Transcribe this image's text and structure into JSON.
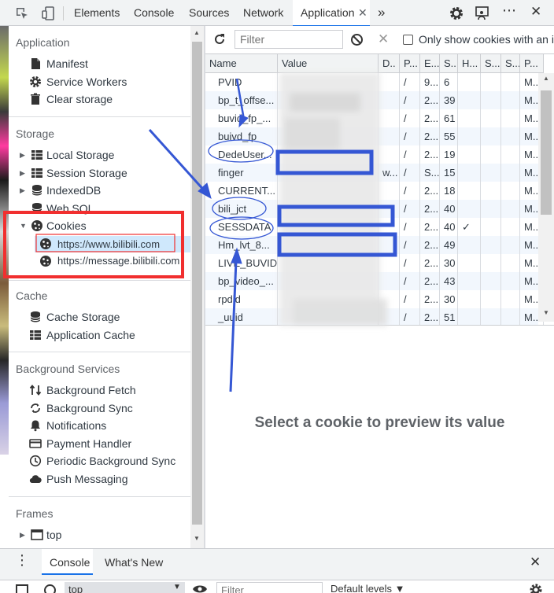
{
  "devtools": {
    "tabs": [
      "Elements",
      "Console",
      "Sources",
      "Network",
      "Application"
    ],
    "active_tab": "Application",
    "more_tabs_icon": "chevron-double-right-icon",
    "toolbar_icons": [
      "inspect-icon",
      "device-toggle-icon",
      "gear-icon",
      "feedback-icon",
      "more-icon",
      "close-icon"
    ]
  },
  "sidebar": {
    "application": {
      "title": "Application",
      "items": [
        "Manifest",
        "Service Workers",
        "Clear storage"
      ]
    },
    "storage": {
      "title": "Storage",
      "items": [
        "Local Storage",
        "Session Storage",
        "IndexedDB",
        "Web SQL",
        "Cookies"
      ],
      "cookies_children": [
        "https://www.bilibili.com",
        "https://message.bilibili.com"
      ]
    },
    "cache": {
      "title": "Cache",
      "items": [
        "Cache Storage",
        "Application Cache"
      ]
    },
    "background": {
      "title": "Background Services",
      "items": [
        "Background Fetch",
        "Background Sync",
        "Notifications",
        "Payment Handler",
        "Periodic Background Sync",
        "Push Messaging"
      ]
    },
    "frames": {
      "title": "Frames",
      "items": [
        "top"
      ]
    }
  },
  "cookies_toolbar": {
    "filter_placeholder": "Filter",
    "only_issues_label": "Only show cookies with an iss"
  },
  "cookies_table": {
    "columns": [
      "Name",
      "Value",
      "D..",
      "P...",
      "E...",
      "S...",
      "H...",
      "S...",
      "S...",
      "P..."
    ],
    "rows": [
      {
        "name": "PVID",
        "path": "/",
        "expires": "9...",
        "size": "6",
        "http": "",
        "prio": "M..."
      },
      {
        "name": "bp_t_offse...",
        "path": "/",
        "expires": "2...",
        "size": "39",
        "http": "",
        "prio": "M..."
      },
      {
        "name": "buvid_fp_...",
        "path": "/",
        "expires": "2...",
        "size": "61",
        "http": "",
        "prio": "M..."
      },
      {
        "name": "buivd_fp",
        "path": "/",
        "expires": "2...",
        "size": "55",
        "http": "",
        "prio": "M..."
      },
      {
        "name": "DedeUser...",
        "path": "/",
        "expires": "2...",
        "size": "19",
        "http": "",
        "prio": "M..."
      },
      {
        "name": "finger",
        "domain": "w...",
        "path": "/",
        "expires": "S...",
        "size": "15",
        "http": "",
        "prio": "M..."
      },
      {
        "name": "CURRENT...",
        "path": "/",
        "expires": "2...",
        "size": "18",
        "http": "",
        "prio": "M..."
      },
      {
        "name": "bili_jct",
        "path": "/",
        "expires": "2...",
        "size": "40",
        "http": "",
        "prio": "M..."
      },
      {
        "name": "SESSDATA",
        "path": "/",
        "expires": "2...",
        "size": "40",
        "http": "✓",
        "prio": "M..."
      },
      {
        "name": "Hm_lvt_8...",
        "path": "/",
        "expires": "2...",
        "size": "49",
        "http": "",
        "prio": "M..."
      },
      {
        "name": "LIVE_BUVID",
        "path": "/",
        "expires": "2...",
        "size": "30",
        "http": "",
        "prio": "M..."
      },
      {
        "name": "bp_video_...",
        "path": "/",
        "expires": "2...",
        "size": "43",
        "http": "",
        "prio": "M..."
      },
      {
        "name": "rpdid",
        "path": "/",
        "expires": "2...",
        "size": "30",
        "http": "",
        "prio": "M..."
      },
      {
        "name": "_uuid",
        "path": "/",
        "expires": "2...",
        "size": "51",
        "http": "",
        "prio": "M..."
      }
    ]
  },
  "preview": {
    "message": "Select a cookie to preview its value"
  },
  "drawer": {
    "tabs": [
      "Console",
      "What's New"
    ],
    "active": "Console",
    "context": "top",
    "filter_placeholder": "Filter",
    "levels": "Default levels ▼"
  },
  "colors": {
    "accent": "#1a73e8",
    "selection": "#cfe8fc",
    "annotation_red": "#f12f2f",
    "annotation_blue": "#3557d4"
  }
}
